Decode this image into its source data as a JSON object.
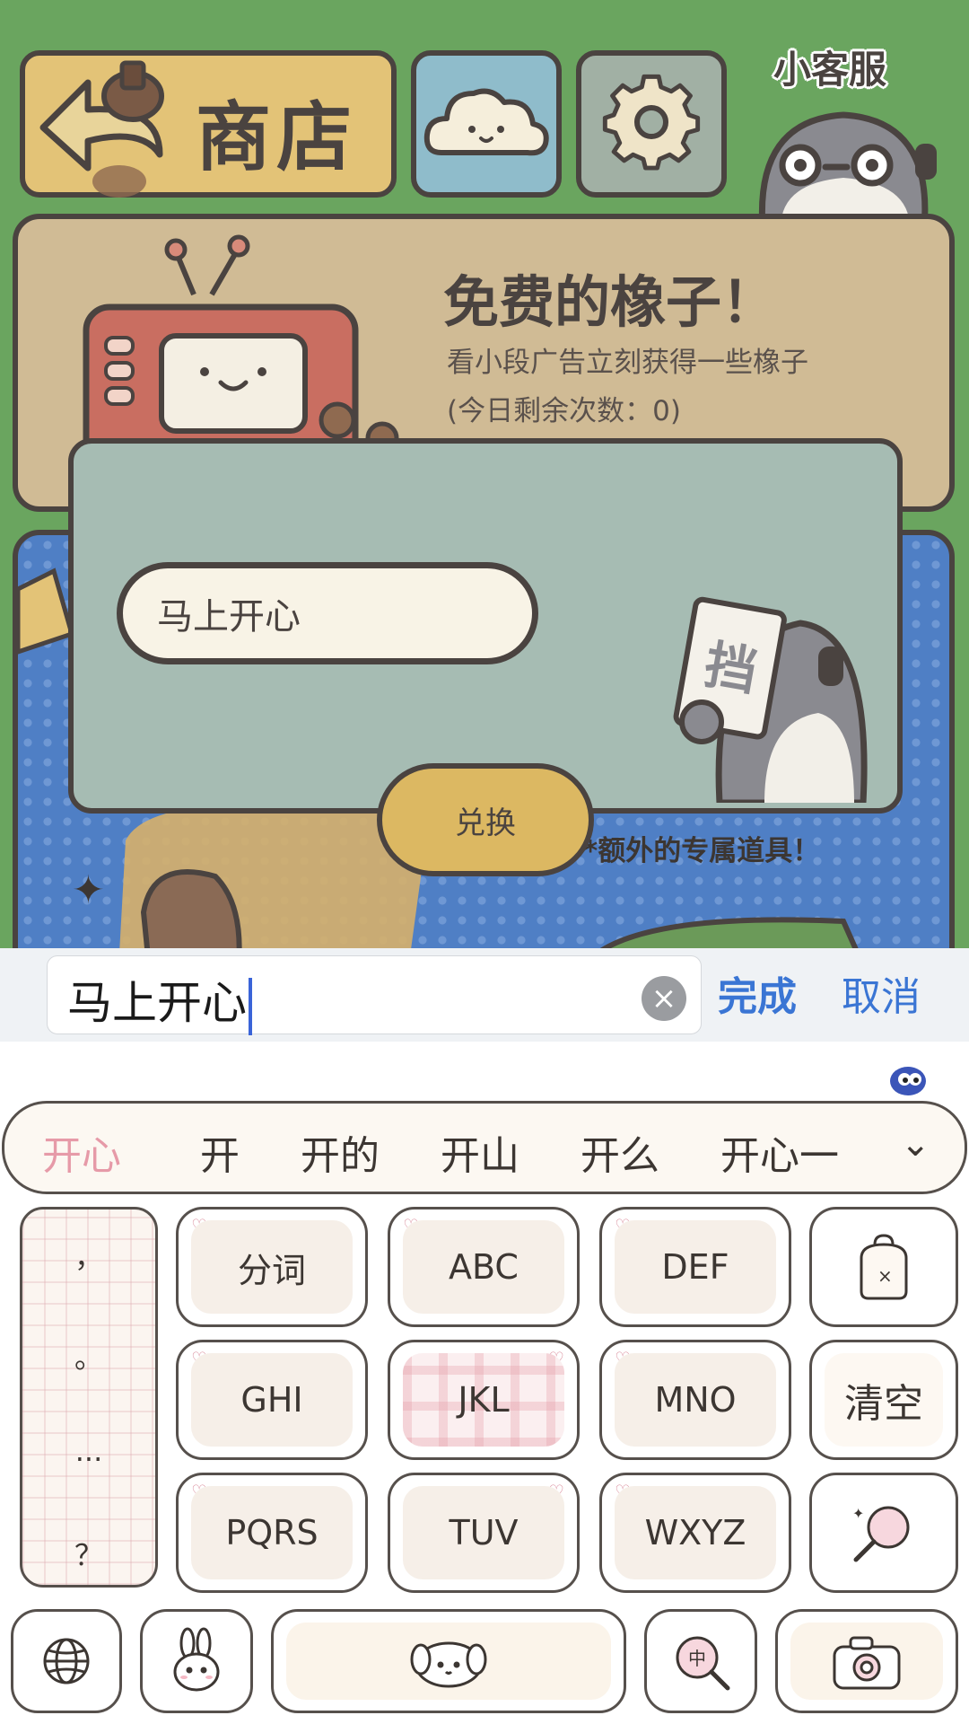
{
  "game": {
    "shop_label": "商店",
    "customer_service_label": "小客服",
    "free_card": {
      "title": "免费的橡子！",
      "subtitle": "看小段广告立刻获得一些橡子",
      "remaining": "(今日剩余次数：0)"
    },
    "extra_props_text": "*额外的专属道具！",
    "redeem_modal": {
      "code_value": "马上开心",
      "redeem_label": "兑换"
    }
  },
  "input_bar": {
    "value": "马上开心",
    "done_label": "完成",
    "cancel_label": "取消"
  },
  "keyboard": {
    "candidates": [
      "开心",
      "开",
      "开的",
      "开山",
      "开么",
      "开心一"
    ],
    "punctuation": [
      "，",
      "。",
      "...",
      "？"
    ],
    "keys": {
      "segment": "分词",
      "abc": "ABC",
      "def": "DEF",
      "ghi": "GHI",
      "jkl": "JKL",
      "mno": "MNO",
      "pqrs": "PQRS",
      "tuv": "TUV",
      "wxyz": "WXYZ",
      "clear": "清空"
    },
    "icons": [
      "globe-icon",
      "bunny-icon",
      "puppy-space-icon",
      "chinese-english-toggle-icon",
      "camera-icon",
      "backpack-delete-icon",
      "magnifier-sticker-icon"
    ]
  }
}
